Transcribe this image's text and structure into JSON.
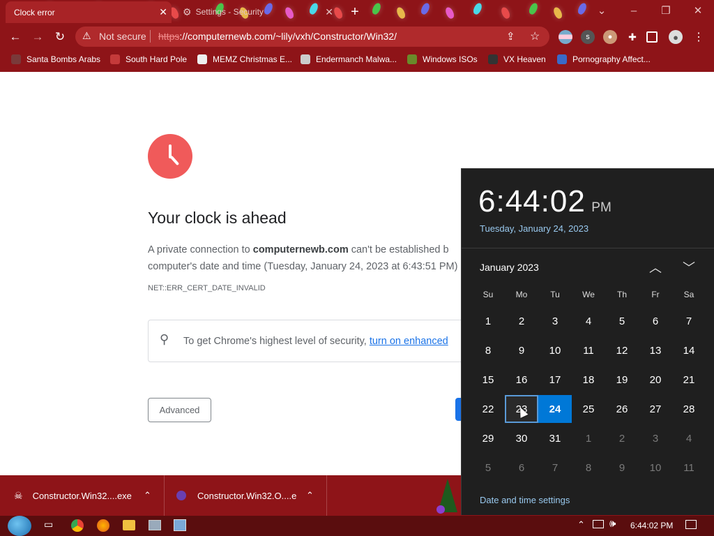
{
  "tabs": [
    {
      "label": "Clock error",
      "active": true
    },
    {
      "label": "Settings - Security",
      "active": false
    }
  ],
  "omnibox": {
    "security_label": "Not secure",
    "url_scheme": "https",
    "url_rest": "://computernewb.com/~lily/vxh/Constructor/Win32/"
  },
  "bookmarks": [
    {
      "label": "Santa Bombs Arabs",
      "icon": "santa-icon"
    },
    {
      "label": "South Hard Pole",
      "icon": "snowflake-icon"
    },
    {
      "label": "MEMZ Christmas E...",
      "icon": "memz-icon"
    },
    {
      "label": "Endermanch Malwa...",
      "icon": "raccoon-icon"
    },
    {
      "label": "Windows ISOs",
      "icon": "tree-icon"
    },
    {
      "label": "VX Heaven",
      "icon": "skull-icon"
    },
    {
      "label": "Pornography Affect...",
      "icon": "figure-icon"
    }
  ],
  "error_page": {
    "heading": "Your clock is ahead",
    "body_prefix": "A private connection to ",
    "body_domain": "computernewb.com",
    "body_suffix": " can't be established b",
    "body_line2": "computer's date and time (Tuesday, January 24, 2023 at 6:43:51 PM)",
    "error_code": "NET::ERR_CERT_DATE_INVALID",
    "tip_text": "To get Chrome's highest level of security, ",
    "tip_link": "turn on enhanced",
    "advanced_label": "Advanced"
  },
  "downloads": [
    {
      "label": "Constructor.Win32....exe"
    },
    {
      "label": "Constructor.Win32.O....e"
    }
  ],
  "calendar": {
    "time": "6:44:02",
    "ampm": "PM",
    "date_long": "Tuesday, January 24, 2023",
    "month_label": "January 2023",
    "weekday_headers": [
      "Su",
      "Mo",
      "Tu",
      "We",
      "Th",
      "Fr",
      "Sa"
    ],
    "weeks": [
      [
        {
          "d": "1"
        },
        {
          "d": "2"
        },
        {
          "d": "3"
        },
        {
          "d": "4"
        },
        {
          "d": "5"
        },
        {
          "d": "6"
        },
        {
          "d": "7"
        }
      ],
      [
        {
          "d": "8"
        },
        {
          "d": "9"
        },
        {
          "d": "10"
        },
        {
          "d": "11"
        },
        {
          "d": "12"
        },
        {
          "d": "13"
        },
        {
          "d": "14"
        }
      ],
      [
        {
          "d": "15"
        },
        {
          "d": "16"
        },
        {
          "d": "17"
        },
        {
          "d": "18"
        },
        {
          "d": "19"
        },
        {
          "d": "20"
        },
        {
          "d": "21"
        }
      ],
      [
        {
          "d": "22"
        },
        {
          "d": "23",
          "hover": true
        },
        {
          "d": "24",
          "today": true
        },
        {
          "d": "25"
        },
        {
          "d": "26"
        },
        {
          "d": "27"
        },
        {
          "d": "28"
        }
      ],
      [
        {
          "d": "29"
        },
        {
          "d": "30"
        },
        {
          "d": "31"
        },
        {
          "d": "1",
          "dim": true
        },
        {
          "d": "2",
          "dim": true
        },
        {
          "d": "3",
          "dim": true
        },
        {
          "d": "4",
          "dim": true
        }
      ],
      [
        {
          "d": "5",
          "dim": true
        },
        {
          "d": "6",
          "dim": true
        },
        {
          "d": "7",
          "dim": true
        },
        {
          "d": "8",
          "dim": true
        },
        {
          "d": "9",
          "dim": true
        },
        {
          "d": "10",
          "dim": true
        },
        {
          "d": "11",
          "dim": true
        }
      ]
    ],
    "settings_link": "Date and time settings"
  },
  "taskbar": {
    "clock": "6:44:02 PM"
  },
  "colors": {
    "frame": "#8e1418",
    "omnibox": "#b02a2c",
    "calendar_bg": "#1f1f1f",
    "today": "#0078d7",
    "clock_icon": "#f05a5a",
    "link": "#1a73e8"
  }
}
